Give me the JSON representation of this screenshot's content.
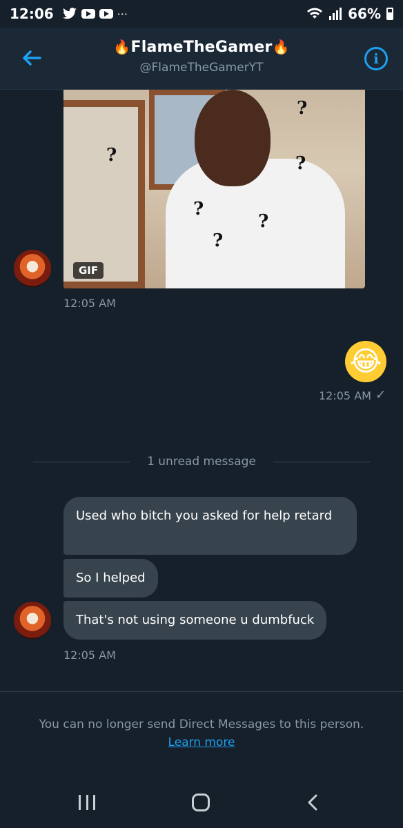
{
  "status_bar": {
    "time": "12:06",
    "battery": "66%",
    "icons": [
      "twitter-icon",
      "youtube-icon",
      "youtube-icon",
      "more-icon",
      "wifi-icon",
      "signal-icon",
      "battery-icon"
    ]
  },
  "header": {
    "title": "FlameTheGamer",
    "handle": "@FlameTheGamerYT"
  },
  "messages": {
    "gif_badge": "GIF",
    "gif_time": "12:05 AM",
    "sent_emoji": "😂",
    "sent_time": "12:05 AM",
    "unread_label": "1 unread message",
    "bubbles": [
      "Used who bitch you asked for help retard",
      "So I helped",
      "That's not using someone u dumbfuck"
    ],
    "received_time": "12:05 AM"
  },
  "footer": {
    "notice": "You can no longer send Direct Messages to this person.",
    "link": "Learn more"
  },
  "colors": {
    "background": "#15202b",
    "accent": "#1da1f2",
    "bubble": "#38444d",
    "muted": "#8899a6"
  }
}
